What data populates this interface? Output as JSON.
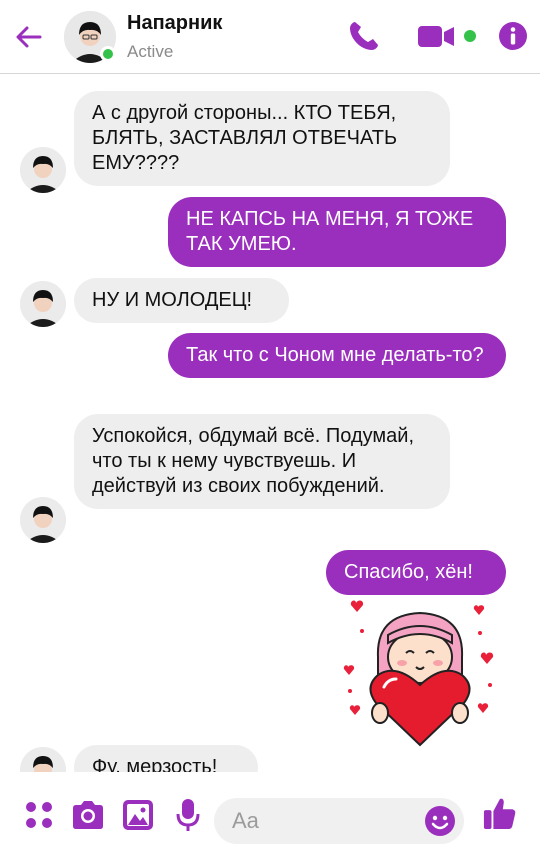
{
  "header": {
    "contact_name": "Напарник",
    "status": "Active"
  },
  "messages": [
    {
      "side": "in",
      "text": "А с другой стороны... КТО ТЕБЯ, БЛЯТЬ, ЗАСТАВЛЯЛ ОТВЕЧАТЬ ЕМУ????"
    },
    {
      "side": "out",
      "text": "НЕ КАПСЬ НА МЕНЯ, Я ТОЖЕ ТАК УМЕЮ."
    },
    {
      "side": "in",
      "text": "НУ И МОЛОДЕЦ!"
    },
    {
      "side": "out",
      "text": "Так что с Чоном мне делать-то?"
    },
    {
      "side": "in",
      "text": "Успокойся, обдумай всё. Подумай, что ты к нему чувствуешь. И действуй из своих побуждений."
    },
    {
      "side": "out",
      "text": "Спасибо, хён!"
    },
    {
      "side": "in",
      "text": "Фу, мерзость!"
    }
  ],
  "composer": {
    "placeholder": "Aa"
  },
  "colors": {
    "accent": "#9b2fbd",
    "incoming_bubble": "#eeeeee",
    "online": "#35c24a"
  },
  "icons": [
    "back-arrow-icon",
    "phone-icon",
    "video-camera-icon",
    "info-icon",
    "apps-grid-icon",
    "camera-icon",
    "image-icon",
    "microphone-icon",
    "emoji-icon",
    "thumbs-up-icon"
  ]
}
